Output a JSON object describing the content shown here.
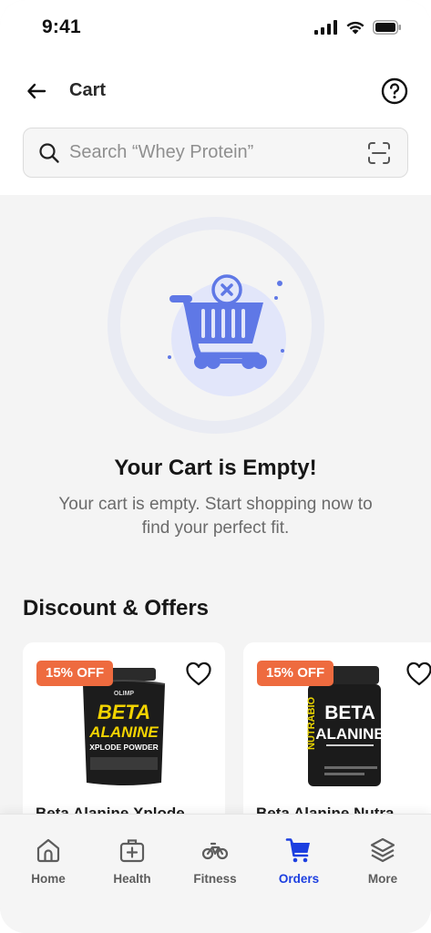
{
  "status": {
    "time": "9:41"
  },
  "header": {
    "title": "Cart"
  },
  "search": {
    "placeholder": "Search “Whey Protein”"
  },
  "empty_state": {
    "title": "Your Cart is Empty!",
    "description": "Your cart is empty. Start shopping now to find your perfect fit."
  },
  "offers": {
    "title": "Discount & Offers",
    "items": [
      {
        "badge": "15% OFF",
        "name": "Beta Alanine Xplode",
        "image_brand": "OLIMP",
        "image_lines": [
          "BETA",
          "ALANINE",
          "XPLODE POWDER"
        ]
      },
      {
        "badge": "15% OFF",
        "name": "Beta Alanine Nutra",
        "image_brand": "NUTRABIO",
        "image_lines": [
          "BETA",
          "ALANINE"
        ]
      }
    ]
  },
  "nav": {
    "items": [
      {
        "label": "Home",
        "icon": "home-icon"
      },
      {
        "label": "Health",
        "icon": "health-kit-icon"
      },
      {
        "label": "Fitness",
        "icon": "bicycle-icon"
      },
      {
        "label": "Orders",
        "icon": "cart-icon"
      },
      {
        "label": "More",
        "icon": "layers-icon"
      }
    ],
    "active": "Orders"
  },
  "colors": {
    "accent": "#1c3fe0",
    "badge": "#ee6b3f",
    "illustration": "#5f78e6"
  }
}
